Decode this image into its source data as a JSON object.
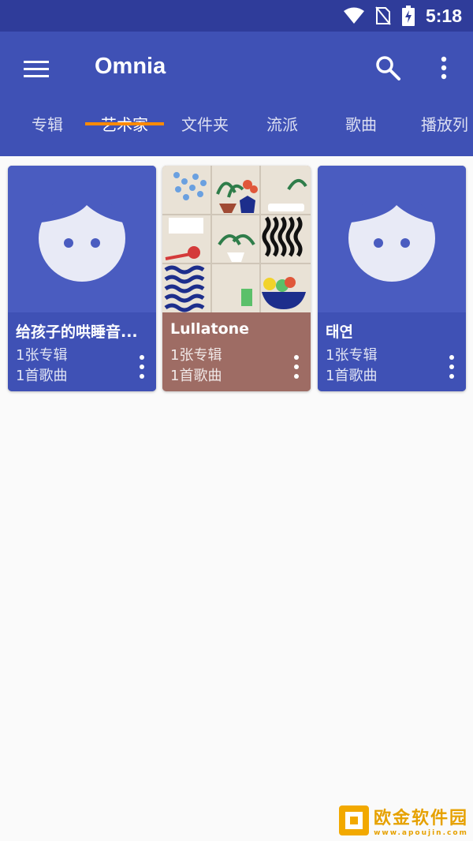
{
  "status_bar": {
    "time": "5:18"
  },
  "app_bar": {
    "title": "Omnia"
  },
  "tabs": [
    {
      "label": "专辑",
      "active": false
    },
    {
      "label": "艺术家",
      "active": true
    },
    {
      "label": "文件夹",
      "active": false
    },
    {
      "label": "流派",
      "active": false
    },
    {
      "label": "歌曲",
      "active": false
    },
    {
      "label": "播放列",
      "active": false
    }
  ],
  "artists": [
    {
      "name": "给孩子的哄睡音...",
      "albums": "1张专辑",
      "songs": "1首歌曲",
      "art": "default-avatar-icon",
      "color": "#3f51b5"
    },
    {
      "name": "Lullatone",
      "albums": "1张专辑",
      "songs": "1首歌曲",
      "art": "album-artwork",
      "color": "#9e6c64"
    },
    {
      "name": "태연",
      "albums": "1张专辑",
      "songs": "1首歌曲",
      "art": "default-avatar-icon",
      "color": "#3f51b5"
    }
  ],
  "watermark": {
    "text": "欧金软件园",
    "url": "www.apoujin.com"
  },
  "colors": {
    "primary": "#3f51b5",
    "status_bar": "#2f3c9a",
    "accent": "#ff8a00"
  }
}
